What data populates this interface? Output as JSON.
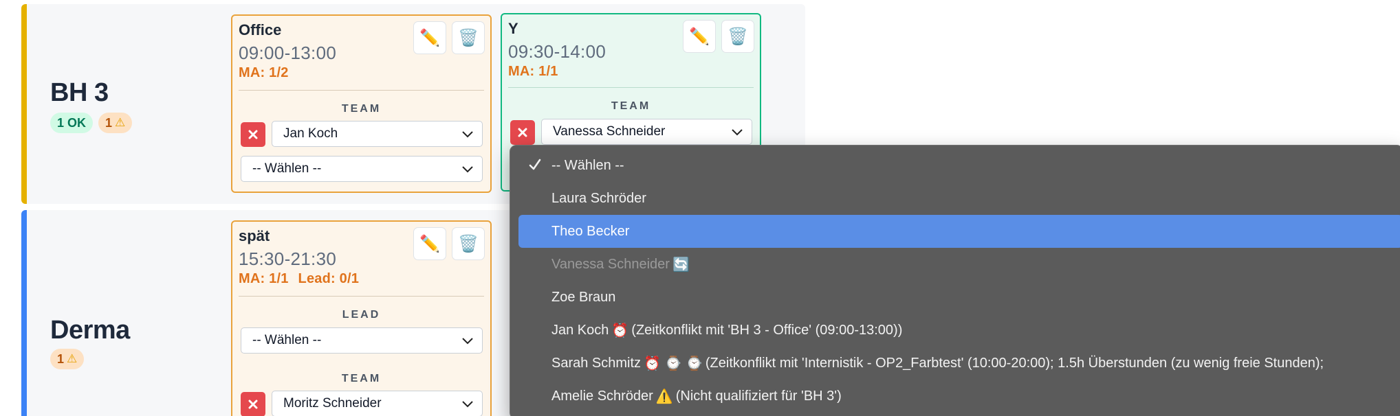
{
  "departments": [
    {
      "name": "BH 3",
      "badges": {
        "ok": "1 OK",
        "warn": "1"
      },
      "shifts": [
        {
          "name": "Office",
          "time": "09:00-13:00",
          "ma": "MA: 1/2",
          "team_label": "TEAM",
          "team_members": [
            "Jan Koch"
          ],
          "empty_select": "-- Wählen --"
        },
        {
          "name": "Y",
          "time": "09:30-14:00",
          "ma": "MA: 1/1",
          "team_label": "TEAM",
          "team_members": [
            "Vanessa Schneider"
          ]
        }
      ]
    },
    {
      "name": "Derma",
      "badges": {
        "warn": "1"
      },
      "shifts": [
        {
          "name": "spät",
          "time": "15:30-21:30",
          "ma": "MA: 1/1",
          "lead": "Lead: 0/1",
          "lead_label": "LEAD",
          "lead_select": "-- Wählen --",
          "team_label": "TEAM",
          "team_members": [
            "Moritz Schneider"
          ]
        }
      ]
    }
  ],
  "dropdown": {
    "items": [
      {
        "label": "-- Wählen --",
        "state": "selected"
      },
      {
        "label": "Laura Schröder",
        "state": "normal"
      },
      {
        "label": "Theo Becker",
        "state": "highlighted"
      },
      {
        "label": "Vanessa Schneider",
        "suffix": "🔄",
        "state": "disabled"
      },
      {
        "label": "Zoe Braun",
        "state": "normal"
      },
      {
        "label": "Jan Koch",
        "icons": "⏰",
        "note": "(Zeitkonflikt mit 'BH 3 - Office' (09:00-13:00))",
        "state": "normal"
      },
      {
        "label": "Sarah Schmitz",
        "icons": "⏰ ⌚ ⌚",
        "note": "(Zeitkonflikt mit 'Internistik - OP2_Farbtest' (10:00-20:00); 1.5h Überstunden (zu wenig freie Stunden);",
        "state": "normal"
      },
      {
        "label": "Amelie Schröder",
        "icons": "⚠️",
        "note": "(Nicht qualifiziert für 'BH 3')",
        "state": "normal"
      }
    ]
  },
  "colors": {
    "bh3_accent": "#e5b100",
    "derma_accent": "#3b82f6",
    "orange_card_border": "#e9a23b",
    "teal_card_border": "#10b981",
    "remove_red": "#e5484d",
    "dropdown_bg": "#5b5b5b",
    "dropdown_highlight": "#5a8ee6"
  }
}
